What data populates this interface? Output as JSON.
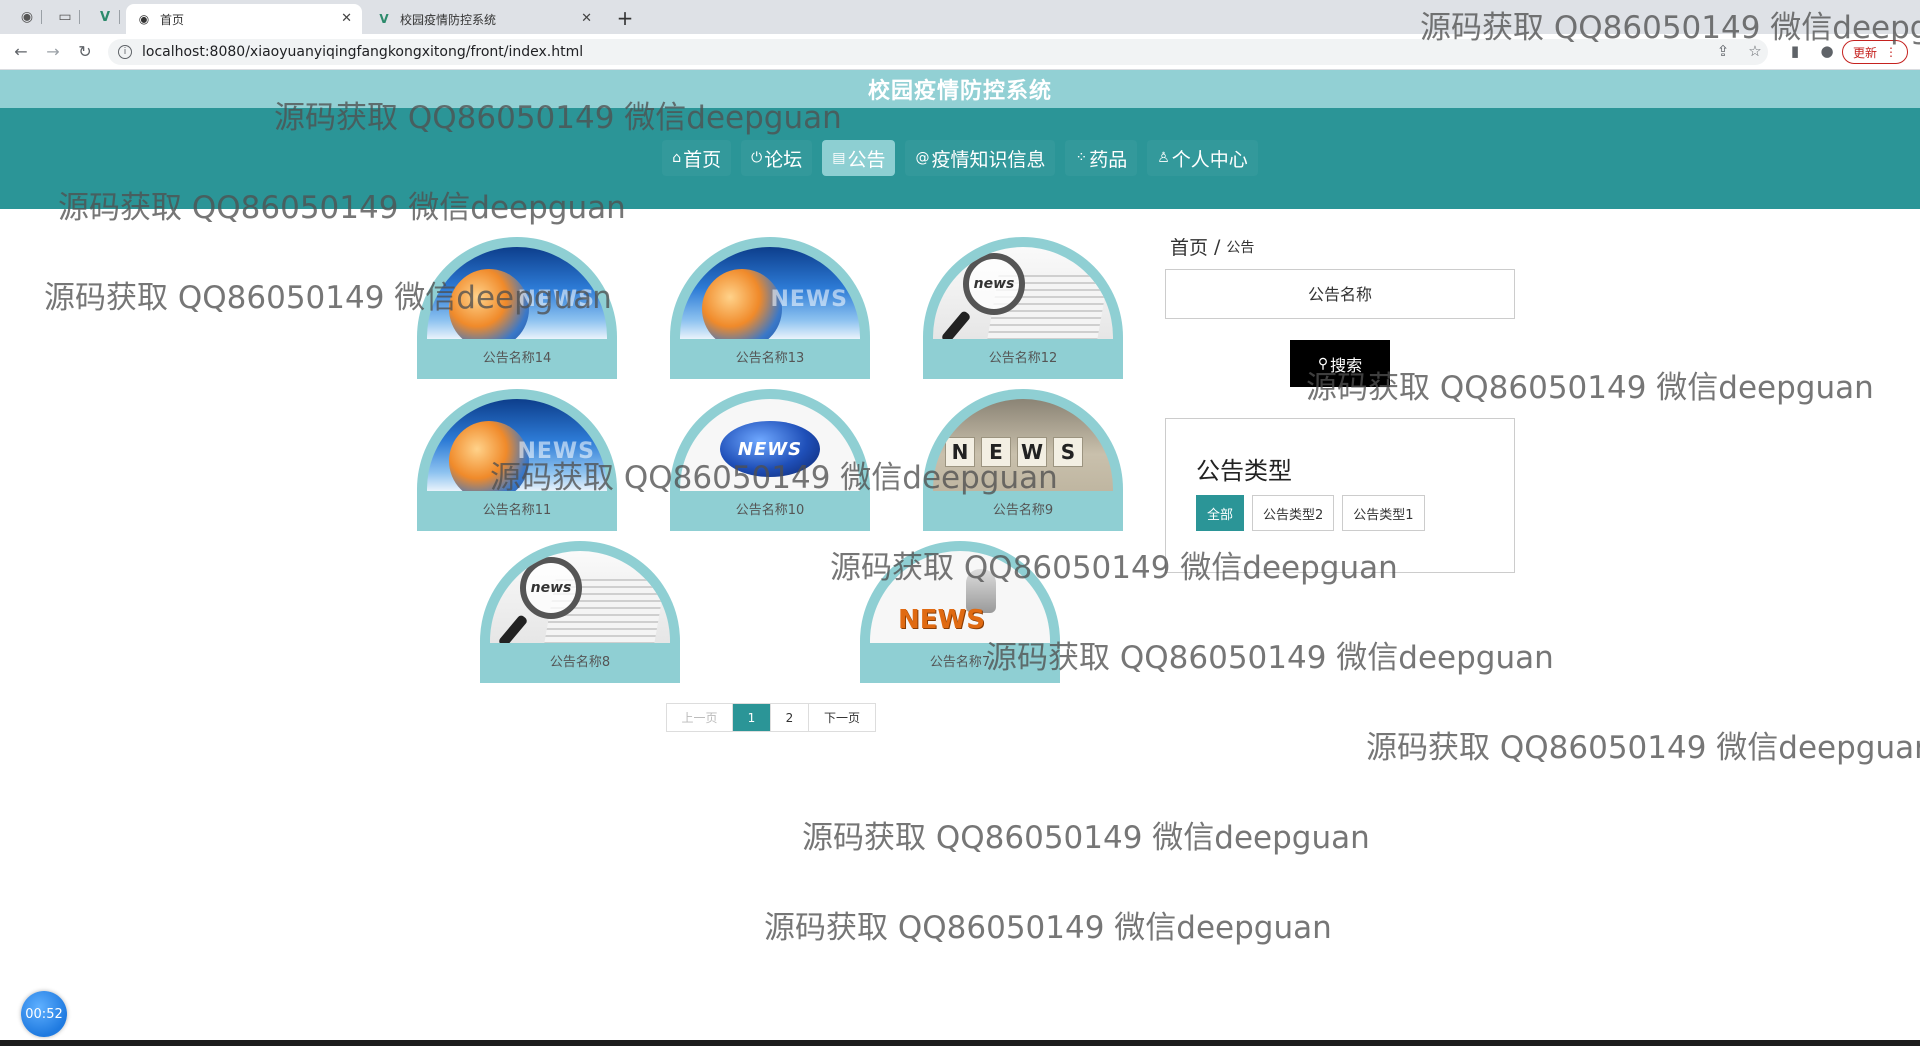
{
  "browser": {
    "tabs": [
      {
        "title": "首页",
        "active": true
      },
      {
        "title": "校园疫情防控系统",
        "active": false
      }
    ],
    "url": "localhost:8080/xiaoyuanyiqingfangkongxitong/front/index.html",
    "update_label": "更新"
  },
  "site": {
    "title": "校园疫情防控系统",
    "nav": [
      {
        "label": "首页",
        "icon": "home-icon",
        "glyph": "⌂"
      },
      {
        "label": "论坛",
        "icon": "power-icon",
        "glyph": "⏻"
      },
      {
        "label": "公告",
        "icon": "notice-icon",
        "glyph": "▤",
        "active": true
      },
      {
        "label": "疫情知识信息",
        "icon": "at-icon",
        "glyph": "@"
      },
      {
        "label": "药品",
        "icon": "grid-icon",
        "glyph": "⁘"
      },
      {
        "label": "个人中心",
        "icon": "user-icon",
        "glyph": "♙"
      }
    ]
  },
  "notices": [
    {
      "name": "公告名称14",
      "image": "globe-news"
    },
    {
      "name": "公告名称13",
      "image": "globe-news"
    },
    {
      "name": "公告名称12",
      "image": "magnifier-news"
    },
    {
      "name": "公告名称11",
      "image": "globe-news"
    },
    {
      "name": "公告名称10",
      "image": "shield-news"
    },
    {
      "name": "公告名称9",
      "image": "blocks-news"
    },
    {
      "name": "公告名称8",
      "image": "magnifier-news"
    },
    {
      "name": "公告名称7",
      "image": "3d-news"
    }
  ],
  "image_text": {
    "news_upper": "NEWS",
    "news_lower": "news",
    "news_mixed": "NEWS",
    "blocks": [
      "N",
      "E",
      "W",
      "S"
    ]
  },
  "pagination": {
    "prev": "上一页",
    "pages": [
      "1",
      "2"
    ],
    "current": "1",
    "next": "下一页"
  },
  "sidebar": {
    "breadcrumb_home": "首页",
    "breadcrumb_sep": "/",
    "breadcrumb_current": "公告",
    "search_placeholder": "公告名称",
    "search_label": "搜索",
    "type_title": "公告类型",
    "types": [
      {
        "label": "全部",
        "active": true
      },
      {
        "label": "公告类型2"
      },
      {
        "label": "公告类型1"
      }
    ]
  },
  "watermark_text": "源码获取 QQ86050149 微信deepguan",
  "timer": "00:52"
}
